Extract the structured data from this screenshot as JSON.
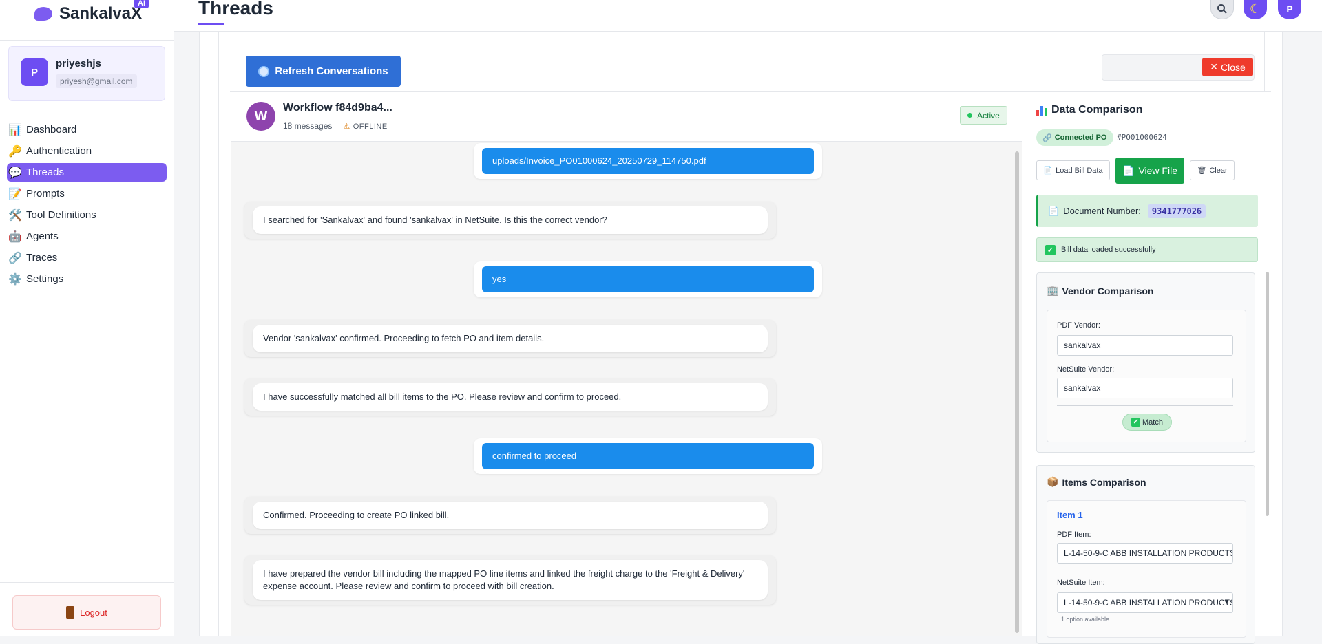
{
  "brand": {
    "name": "SankalvaX",
    "badge": "AI"
  },
  "user": {
    "initial": "P",
    "name": "priyeshjs",
    "email": "priyesh@gmail.com"
  },
  "nav": [
    {
      "label": "Dashboard",
      "icon": "chart-icon",
      "glyph": "📊"
    },
    {
      "label": "Authentication",
      "icon": "key-icon",
      "glyph": "🔑"
    },
    {
      "label": "Threads",
      "icon": "chat-bubble-icon",
      "glyph": "💬",
      "active": true
    },
    {
      "label": "Prompts",
      "icon": "memo-icon",
      "glyph": "📝"
    },
    {
      "label": "Tool Definitions",
      "icon": "tools-icon",
      "glyph": "🛠️"
    },
    {
      "label": "Agents",
      "icon": "robot-icon",
      "glyph": "🤖"
    },
    {
      "label": "Traces",
      "icon": "link-icon",
      "glyph": "🔗"
    },
    {
      "label": "Settings",
      "icon": "gear-icon",
      "glyph": "⚙️"
    }
  ],
  "logout_label": "Logout",
  "header": {
    "title": "Threads",
    "user_initial": "P"
  },
  "toolbar": {
    "refresh_label": "Refresh Conversations",
    "close_label": "Close"
  },
  "workflow": {
    "initial": "W",
    "title": "Workflow f84d9ba4...",
    "message_count": "18 messages",
    "connection": "OFFLINE",
    "status": "Active"
  },
  "messages": [
    {
      "role": "user",
      "text": "uploads/Invoice_PO01000624_20250729_114750.pdf"
    },
    {
      "role": "bot",
      "text": "I searched for 'Sankalvax' and found 'sankalvax' in NetSuite. Is this the correct vendor?"
    },
    {
      "role": "user",
      "text": "yes"
    },
    {
      "role": "bot",
      "text": "Vendor 'sankalvax' confirmed. Proceeding to fetch PO and item details."
    },
    {
      "role": "bot",
      "text": "I have successfully matched all bill items to the PO. Please review and confirm to proceed."
    },
    {
      "role": "user",
      "text": "confirmed to proceed"
    },
    {
      "role": "bot",
      "text": "Confirmed. Proceeding to create PO linked bill."
    },
    {
      "role": "bot",
      "text": "I have prepared the vendor bill including the mapped PO line items and linked the freight charge to the 'Freight & Delivery' expense account. Please review and confirm to proceed with bill creation."
    }
  ],
  "comparison": {
    "title": "Data Comparison",
    "connected_label": "Connected PO",
    "po_number": "#PO01000624",
    "load_label": "Load Bill Data",
    "view_label": "View File",
    "clear_label": "Clear",
    "doc_number_label": "Document Number:",
    "doc_number": "9341777026",
    "loaded_message": "Bill data loaded successfully",
    "vendor": {
      "title": "Vendor Comparison",
      "pdf_label": "PDF Vendor:",
      "pdf_value": "sankalvax",
      "netsuite_label": "NetSuite Vendor:",
      "netsuite_value": "sankalvax",
      "match_label": "Match"
    },
    "items": {
      "title": "Items Comparison",
      "item_heading": "Item 1",
      "pdf_label": "PDF Item:",
      "pdf_value": "L-14-50-9-C ABB INSTALLATION PRODUCTS",
      "netsuite_label": "NetSuite Item:",
      "netsuite_value": "L-14-50-9-C ABB INSTALLATION PRODUCTS",
      "options_hint": "1 option available"
    }
  },
  "colors": {
    "accent": "#6d4df2",
    "user_bubble": "#1a8cec",
    "success": "#16a34a",
    "danger": "#ef3b2c"
  }
}
